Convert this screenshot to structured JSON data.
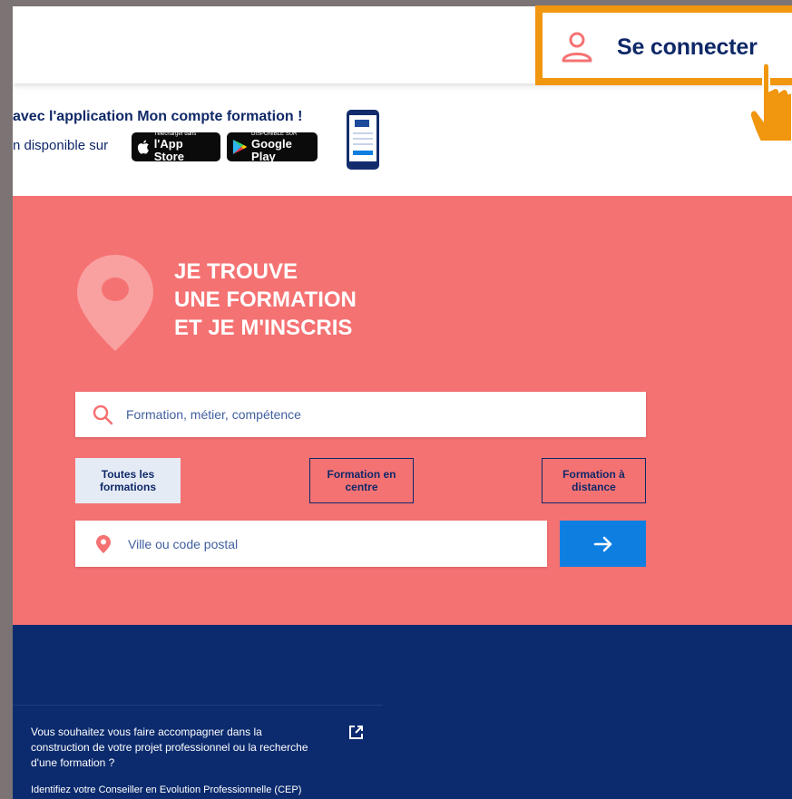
{
  "header": {
    "login_label": "Se connecter"
  },
  "promo": {
    "headline": "avec l'application Mon compte formation !",
    "available": "n disponible sur",
    "appstore": {
      "small": "Télécharger dans",
      "big": "l'App Store"
    },
    "googleplay": {
      "small": "DISPONIBLE SUR",
      "big": "Google Play"
    }
  },
  "hero": {
    "title_lines": [
      "JE TROUVE",
      "UNE FORMATION",
      "ET JE M'INSCRIS"
    ],
    "search_placeholder": "Formation, métier, compétence",
    "filters": {
      "all": "Toutes les formations",
      "centre": "Formation en centre",
      "distance": "Formation à distance"
    },
    "city_placeholder": "Ville ou code postal"
  },
  "footer": {
    "cep_text": "Vous souhaitez vous faire accompagner dans la construction de votre projet professionnel ou la recherche d'une formation ?",
    "cep_link": "Identifiez votre Conseiller en Evolution Professionnelle (CEP)"
  },
  "colors": {
    "brand_navy": "#0f2868",
    "hero_coral": "#f57273",
    "cta_blue": "#0e7fe1",
    "highlight_orange": "#f0960f",
    "footer_navy": "#0c2b6e"
  },
  "icons": [
    "user-icon",
    "pointer-hand-icon",
    "apple-icon",
    "google-play-icon",
    "phone-app-image",
    "location-pin-icon",
    "search-icon",
    "arrow-right-icon",
    "external-link-icon"
  ]
}
